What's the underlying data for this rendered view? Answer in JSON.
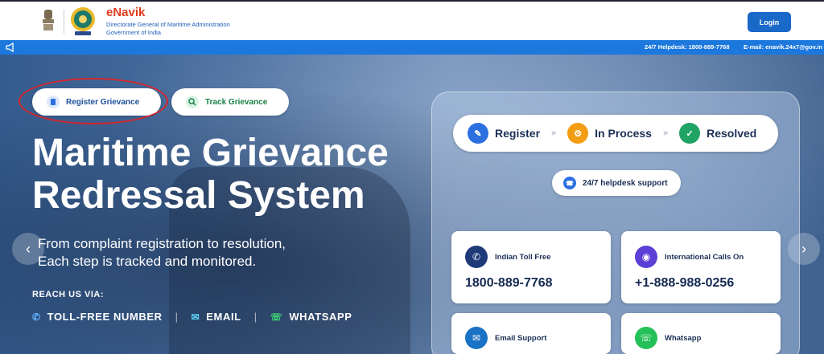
{
  "header": {
    "brand_title": "eNavik",
    "brand_subtitle": "Directorate General of Maritime Administration",
    "brand_gov": "Government of India",
    "login_label": "Login"
  },
  "infobar": {
    "helpdesk": "24/7 Helpdesk: 1800-889-7768",
    "email": "E-mail: enavik.24x7@gov.in"
  },
  "hero": {
    "register_label": "Register Grievance",
    "track_label": "Track Grievance",
    "title_line1": "Maritime Grievance",
    "title_line2": "Redressal System",
    "desc_line1": "From complaint registration to resolution,",
    "desc_line2": "Each step is tracked and monitored.",
    "reach_label": "REACH US VIA:",
    "contacts": {
      "tollfree": "TOLL-FREE NUMBER",
      "email": "EMAIL",
      "whatsapp": "WHATSAPP"
    },
    "prev_arrow": "‹",
    "next_arrow": "›"
  },
  "panel": {
    "steps": [
      {
        "label": "Register",
        "icon": "register-icon",
        "color": "#2b6fe0"
      },
      {
        "label": "In Process",
        "icon": "process-icon",
        "color": "#f29d12"
      },
      {
        "label": "Resolved",
        "icon": "resolved-icon",
        "color": "#1fa464"
      }
    ],
    "helpdesk": "24/7 helpdesk support",
    "cards": [
      {
        "label": "Indian Toll Free",
        "value": "1800-889-7768",
        "icon": "phone-icon",
        "color": "#1e3a78"
      },
      {
        "label": "International Calls On",
        "value": "+1-888-988-0256",
        "icon": "globe-icon",
        "color": "#5b3fd6"
      },
      {
        "label": "Email Support",
        "value": "",
        "icon": "mail-icon",
        "color": "#1a72c4"
      },
      {
        "label": "Whatsapp",
        "value": "",
        "icon": "whatsapp-icon",
        "color": "#25c05a"
      }
    ]
  }
}
